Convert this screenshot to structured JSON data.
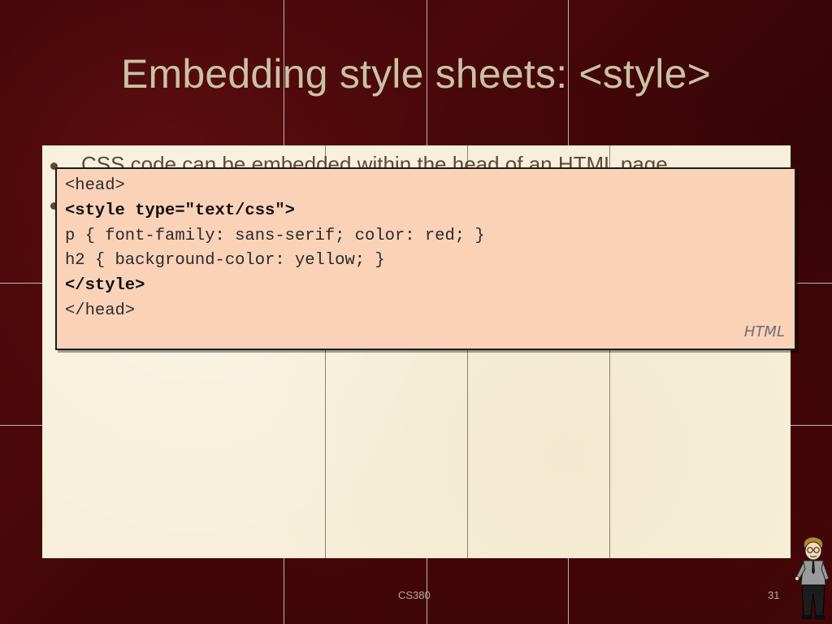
{
  "slide": {
    "title": "Embedding style sheets: <style>",
    "bullets": [
      "CSS code can be embedded within the head of an HTML page",
      ""
    ]
  },
  "code_example": {
    "lines": [
      {
        "text": "<head>",
        "bold": false
      },
      {
        "text": "<style type=\"text/css\">",
        "bold": true
      },
      {
        "text": "p { font-family: sans-serif; color: red; }",
        "bold": false
      },
      {
        "text": "h2 { background-color: yellow; }",
        "bold": false
      },
      {
        "text": "</style>",
        "bold": true
      },
      {
        "text": "</head>",
        "bold": false
      }
    ],
    "language_label": "HTML"
  },
  "footer": {
    "course": "CS380",
    "page_number": "31"
  },
  "icons": {
    "mascot": "cartoon-teacher-icon"
  },
  "colors": {
    "background": "#3d0507",
    "title_text": "#c9c2a4",
    "content_panel": "#f7efd9",
    "code_box_fill": "#fad2b8",
    "bullet_text": "#5c4a36"
  }
}
